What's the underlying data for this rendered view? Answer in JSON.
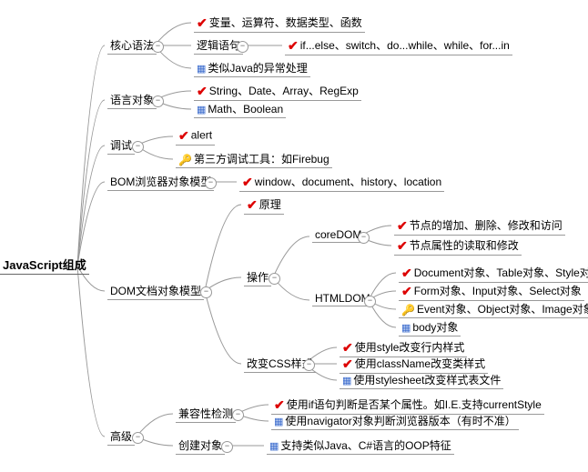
{
  "root": "JavaScript组成",
  "l1": {
    "core": "核心语法",
    "lang": "语言对象",
    "debug": "调试",
    "bom": "BOM浏览器对象模型",
    "dom": "DOM文档对象模型",
    "adv": "高级"
  },
  "core": {
    "basics": "变量、运算符、数据类型、函数",
    "logic": "逻辑语句",
    "flow": "if...else、switch、do...while、while、for...in",
    "exception": "类似Java的异常处理"
  },
  "lang": {
    "a": "String、Date、Array、RegExp",
    "b": "Math、Boolean"
  },
  "debug": {
    "alert": "alert",
    "firebug": "第三方调试工具：如Firebug"
  },
  "bom": {
    "items": "window、document、history、location"
  },
  "dom": {
    "principle": "原理",
    "op": "操作",
    "css": "改变CSS样式",
    "coredom": "coreDOM",
    "htmldom": "HTMLDOM",
    "core1": "节点的增加、删除、修改和访问",
    "core2": "节点属性的读取和修改",
    "html1": "Document对象、Table对象、Style对象",
    "html2": "Form对象、Input对象、Select对象",
    "html3": "Event对象、Object对象、Image对象",
    "html4": "body对象",
    "css1": "使用style改变行内样式",
    "css2": "使用className改变类样式",
    "css3": "使用stylesheet改变样式表文件"
  },
  "adv": {
    "compat": "兼容性检测",
    "create": "创建对象",
    "compat1": "使用if语句判断是否某个属性。如I.E.支持currentStyle",
    "compat2": "使用navigator对象判断浏览器版本（有时不准）",
    "create1": "支持类似Java、C#语言的OOP特征"
  },
  "icons": {
    "check": "✔",
    "key": "🔑",
    "grid": "▦"
  }
}
